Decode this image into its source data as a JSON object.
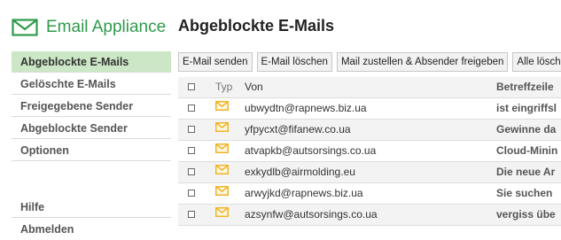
{
  "app": {
    "title": "Email Appliance",
    "accent_color": "#2e9b4b",
    "active_nav_color": "#cbe7c5"
  },
  "page": {
    "title": "Abgeblockte E-Mails"
  },
  "sidebar": {
    "items": [
      {
        "label": "Abgeblockte E-Mails",
        "active": true
      },
      {
        "label": "Gelöschte E-Mails"
      },
      {
        "label": "Freigegebene Sender"
      },
      {
        "label": "Abgeblockte Sender"
      },
      {
        "label": "Optionen"
      }
    ],
    "bottom": [
      {
        "label": "Hilfe"
      },
      {
        "label": "Abmelden"
      }
    ]
  },
  "toolbar": {
    "buttons": [
      {
        "label": "E-Mail senden"
      },
      {
        "label": "E-Mail löschen"
      },
      {
        "label": "Mail zustellen & Absender freigeben"
      },
      {
        "label": "Alle löschen"
      }
    ]
  },
  "table": {
    "columns": {
      "typ": "Typ",
      "von": "Von",
      "betreffzeile": "Betreffzeile"
    },
    "rows": [
      {
        "von": "ubwydtn@rapnews.biz.ua",
        "betreff": "ist eingriffsl",
        "icon": "envelope-icon"
      },
      {
        "von": "yfpycxt@fifanew.co.ua",
        "betreff": "Gewinne da",
        "icon": "envelope-icon"
      },
      {
        "von": "atvapkb@autsorsings.co.ua",
        "betreff": "Cloud-Minin",
        "icon": "envelope-icon"
      },
      {
        "von": "exkydlb@airmolding.eu",
        "betreff": "Die neue Ar",
        "icon": "envelope-icon"
      },
      {
        "von": "arwyjkd@rapnews.biz.ua",
        "betreff": "Sie suchen",
        "icon": "envelope-icon"
      },
      {
        "von": "azsynfw@autsorsings.co.ua",
        "betreff": "vergiss übe",
        "icon": "envelope-icon"
      }
    ]
  }
}
